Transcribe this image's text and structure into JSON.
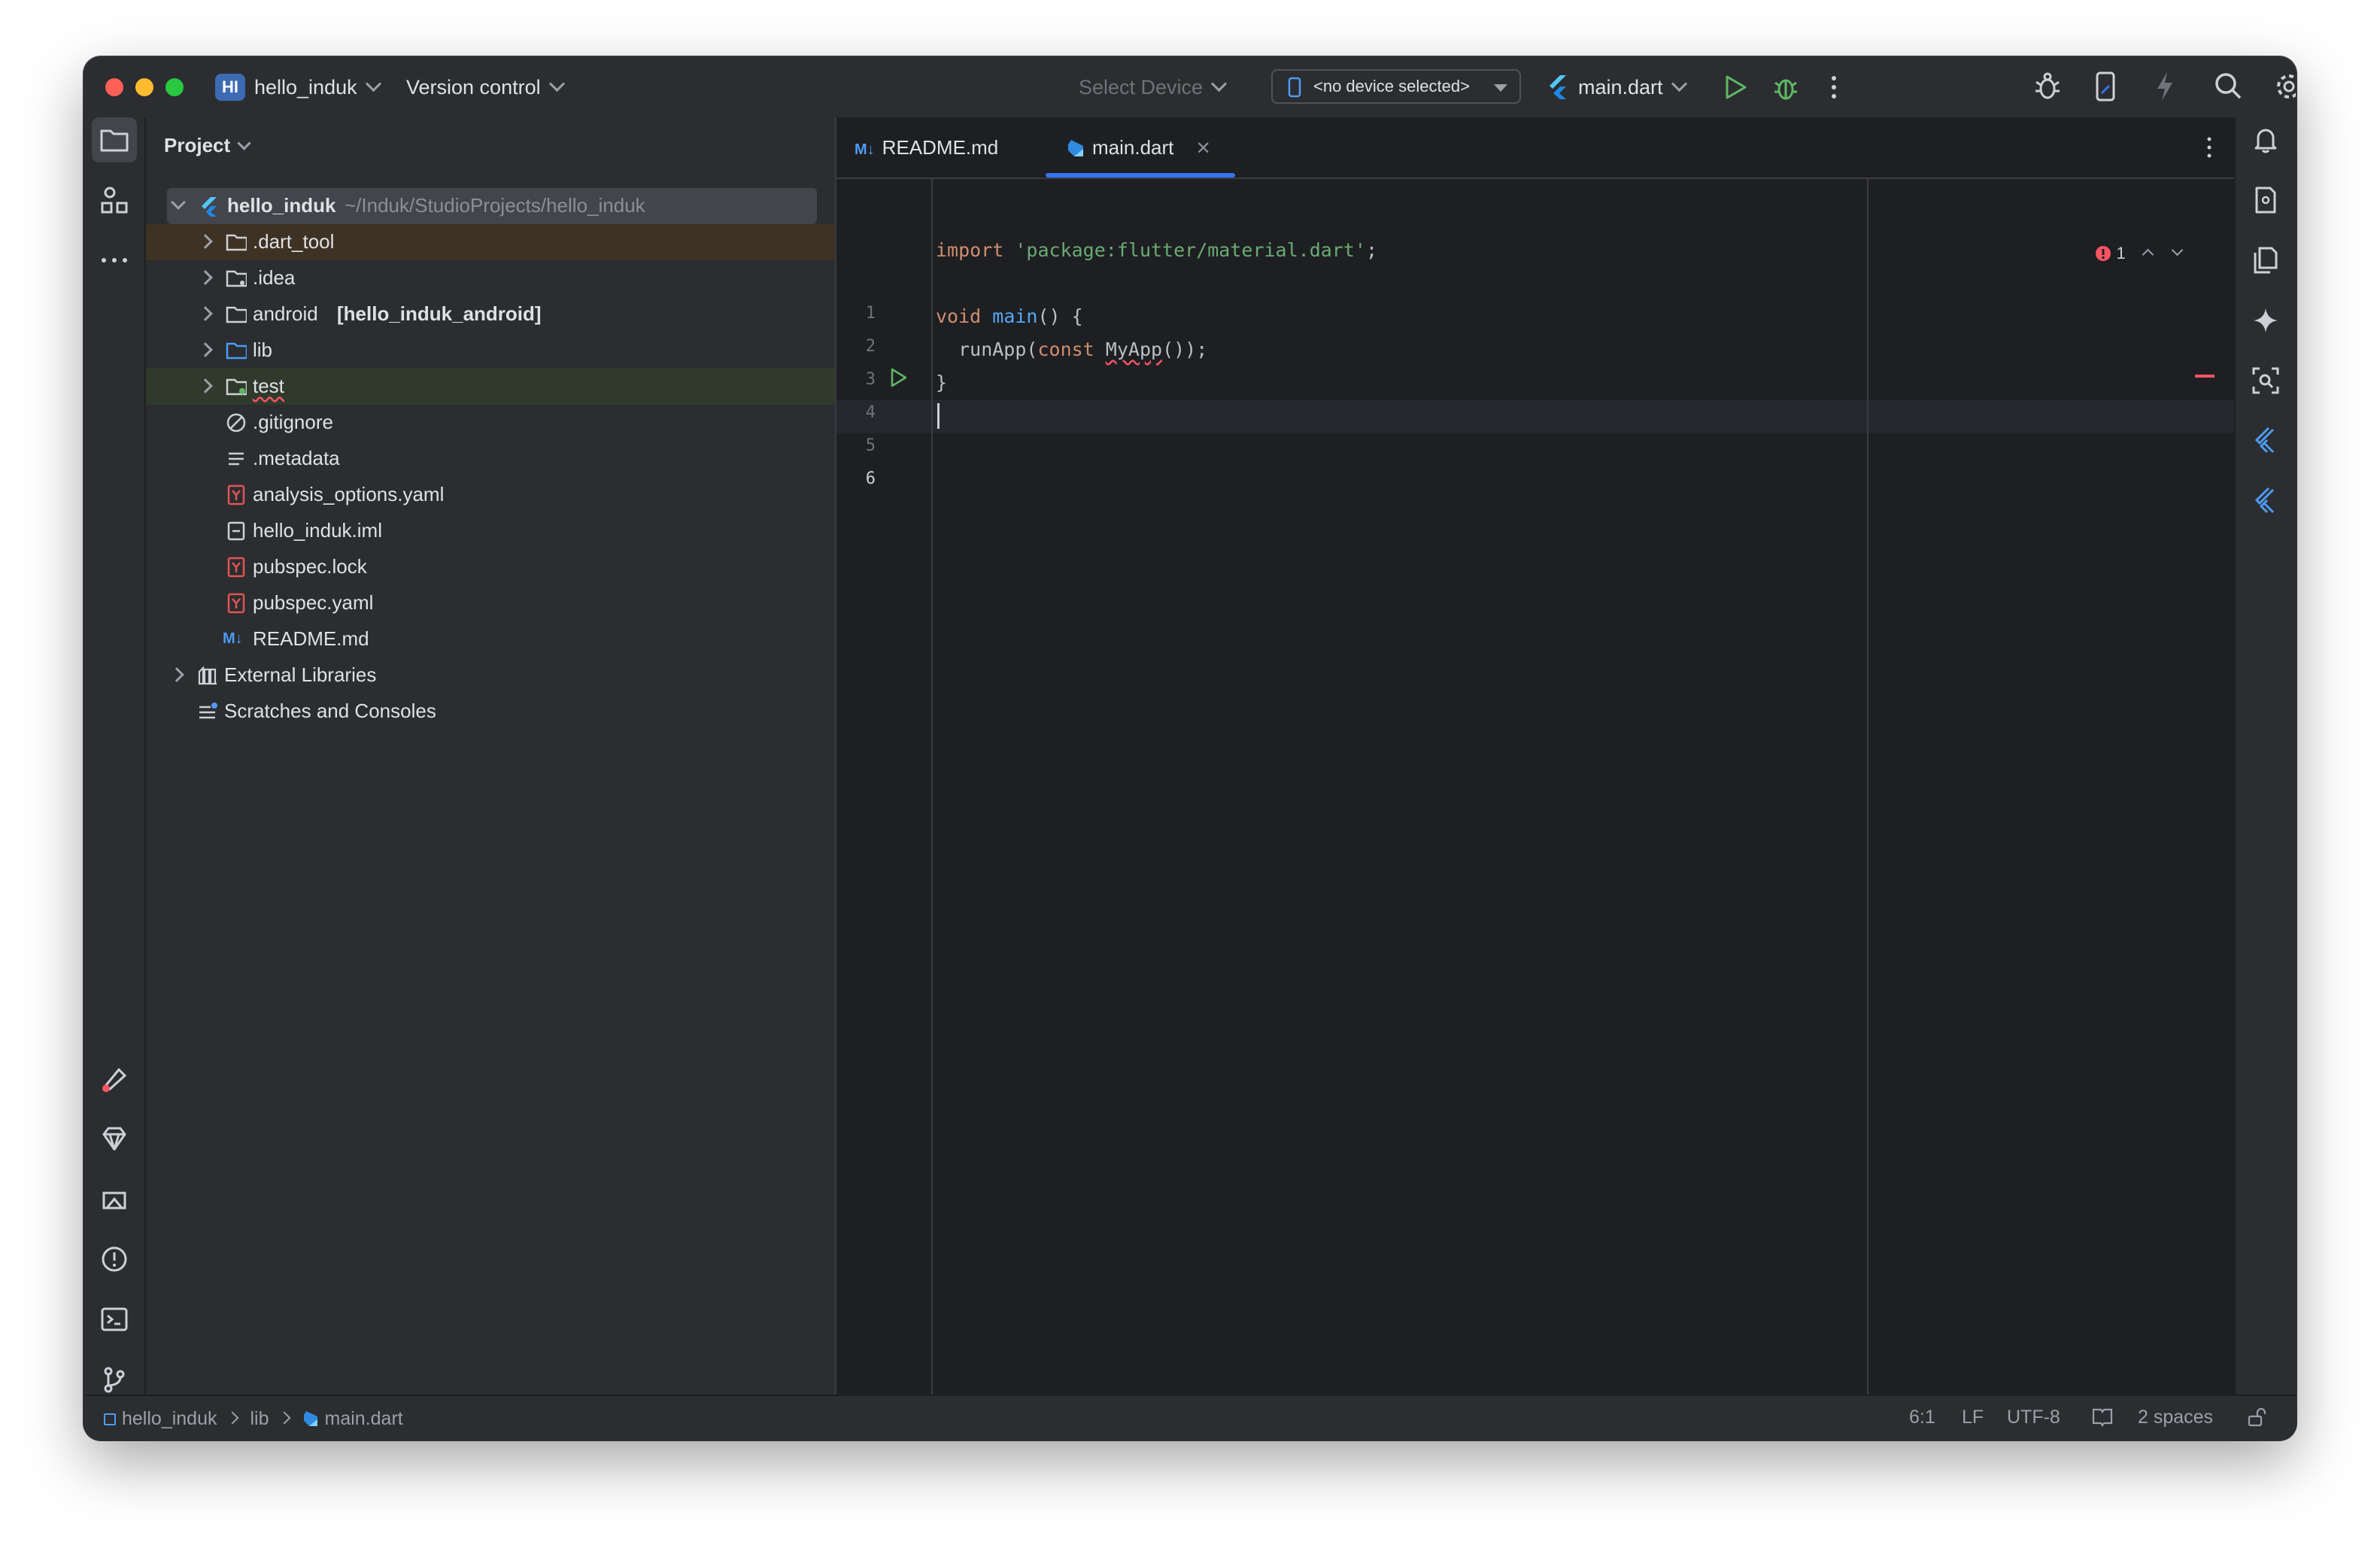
{
  "titlebar": {
    "project_badge": "HI",
    "project_name": "hello_induk",
    "version_control": "Version control",
    "select_device": "Select Device",
    "device_selector": "<no device selected>",
    "run_config": "main.dart"
  },
  "project_panel": {
    "title": "Project",
    "root": {
      "name": "hello_induk",
      "path": "~/Induk/StudioProjects/hello_induk"
    },
    "items": [
      {
        "label": ".dart_tool",
        "type": "folder"
      },
      {
        "label": ".idea",
        "type": "folder"
      },
      {
        "label": "android",
        "suffix": "[hello_induk_android]",
        "type": "folder"
      },
      {
        "label": "lib",
        "type": "folder"
      },
      {
        "label": "test",
        "type": "folder"
      },
      {
        "label": ".gitignore",
        "type": "file"
      },
      {
        "label": ".metadata",
        "type": "file"
      },
      {
        "label": "analysis_options.yaml",
        "type": "yaml"
      },
      {
        "label": "hello_induk.iml",
        "type": "file"
      },
      {
        "label": "pubspec.lock",
        "type": "yaml"
      },
      {
        "label": "pubspec.yaml",
        "type": "yaml"
      },
      {
        "label": "README.md",
        "type": "markdown"
      }
    ],
    "external_libraries": "External Libraries",
    "scratches": "Scratches and Consoles"
  },
  "editor": {
    "tabs": [
      {
        "label": "README.md",
        "icon": "M↓"
      },
      {
        "label": "main.dart",
        "active": true
      }
    ],
    "problems_count": "1",
    "line_numbers": [
      "1",
      "2",
      "3",
      "4",
      "5",
      "6"
    ],
    "code": {
      "l1_kw": "import",
      "l1_str": "'package:flutter/material.dart'",
      "l1_end": ";",
      "l3_kw": "void",
      "l3_fn": "main",
      "l3_end": "() {",
      "l4_a": "  runApp(",
      "l4_kw": "const",
      "l4_cls": "MyApp",
      "l4_end": "());",
      "l5": "}"
    }
  },
  "statusbar": {
    "breadcrumb": [
      "hello_induk",
      "lib",
      "main.dart"
    ],
    "position": "6:1",
    "line_sep": "LF",
    "encoding": "UTF-8",
    "indent": "2 spaces"
  },
  "colors": {
    "accent": "#3574f0",
    "error": "#f75464",
    "run_green": "#5fb865"
  }
}
